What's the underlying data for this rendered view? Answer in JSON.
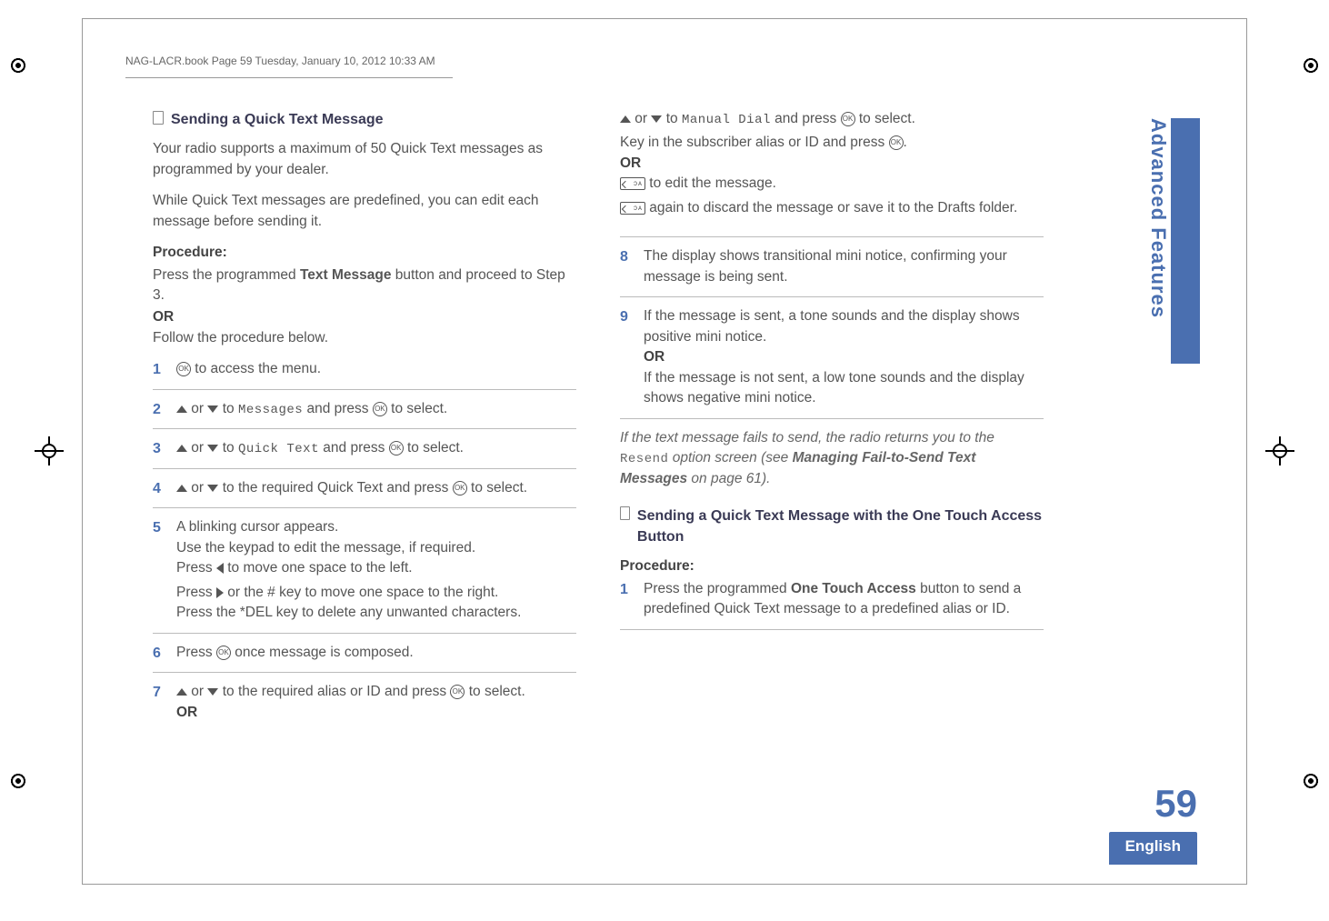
{
  "header": {
    "crop_info": "NAG-LACR.book  Page 59  Tuesday, January 10, 2012  10:33 AM"
  },
  "section1": {
    "title": "Sending a Quick Text Message",
    "intro1": "Your radio supports a maximum of 50 Quick Text messages as programmed by your dealer.",
    "intro2": "While Quick Text messages are predefined, you can edit each message before sending it.",
    "procedure_label": "Procedure:",
    "pre_step_a": "Press the programmed ",
    "pre_step_bold": "Text Message",
    "pre_step_b": " button and proceed to Step 3.",
    "or": "OR",
    "pre_step_c": "Follow the procedure below.",
    "steps": [
      {
        "n": "1",
        "a": " to access the menu."
      },
      {
        "n": "2",
        "a": " or ",
        "b": " to ",
        "lcd": "Messages",
        "c": " and press ",
        "d": " to select."
      },
      {
        "n": "3",
        "a": " or ",
        "b": " to ",
        "lcd": "Quick Text",
        "c": " and press ",
        "d": " to select."
      },
      {
        "n": "4",
        "a": " or ",
        "b": " to the required Quick Text and press ",
        "d": " to select."
      },
      {
        "n": "5",
        "l1": "A blinking cursor appears.",
        "l2": "Use the keypad to edit the message, if required.",
        "l3a": "Press ",
        "l3b": " to move one space to the left.",
        "l4a": "Press ",
        "l4b": " or the # key to move one space to the right.",
        "l5": "Press the *DEL key to delete any unwanted characters."
      },
      {
        "n": "6",
        "a": "Press ",
        "b": " once message is composed."
      },
      {
        "n": "7",
        "a": " or ",
        "b": " to the required alias or ID and press ",
        "d": " to select.",
        "or": "OR"
      }
    ]
  },
  "col2_top": {
    "l1a": " or ",
    "l1b": " to ",
    "l1_lcd": "Manual Dial",
    "l1c": " and press ",
    "l1d": " to select.",
    "l2a": "Key in the subscriber alias or ID and press  ",
    "l2b": ".",
    "or": "OR",
    "l3": " to edit the message.",
    "l4": " again to discard the message or save it to the Drafts folder."
  },
  "col2_steps": [
    {
      "n": "8",
      "t": "The display shows transitional mini notice, confirming your message is being sent."
    },
    {
      "n": "9",
      "t1": "If the message is sent, a tone sounds and the display shows positive mini notice.",
      "or": "OR",
      "t2": "If the message is not sent, a low tone sounds and the display shows negative mini notice."
    }
  ],
  "note": {
    "a": "If the text message fails to send, the radio returns you to the ",
    "lcd": "Resend",
    "b": " option screen (see ",
    "bold": "Managing Fail-to-Send Text Messages",
    "c": " on page 61)."
  },
  "section2": {
    "title": "Sending a Quick Text Message with the One Touch Access Button",
    "procedure_label": "Procedure:",
    "step1_n": "1",
    "step1_a": "Press the programmed ",
    "step1_bold": "One Touch Access",
    "step1_b": " button to send a predefined Quick Text message to a predefined alias or ID."
  },
  "sidebar": {
    "chapter": "Advanced Features",
    "page_num": "59",
    "language": "English"
  }
}
